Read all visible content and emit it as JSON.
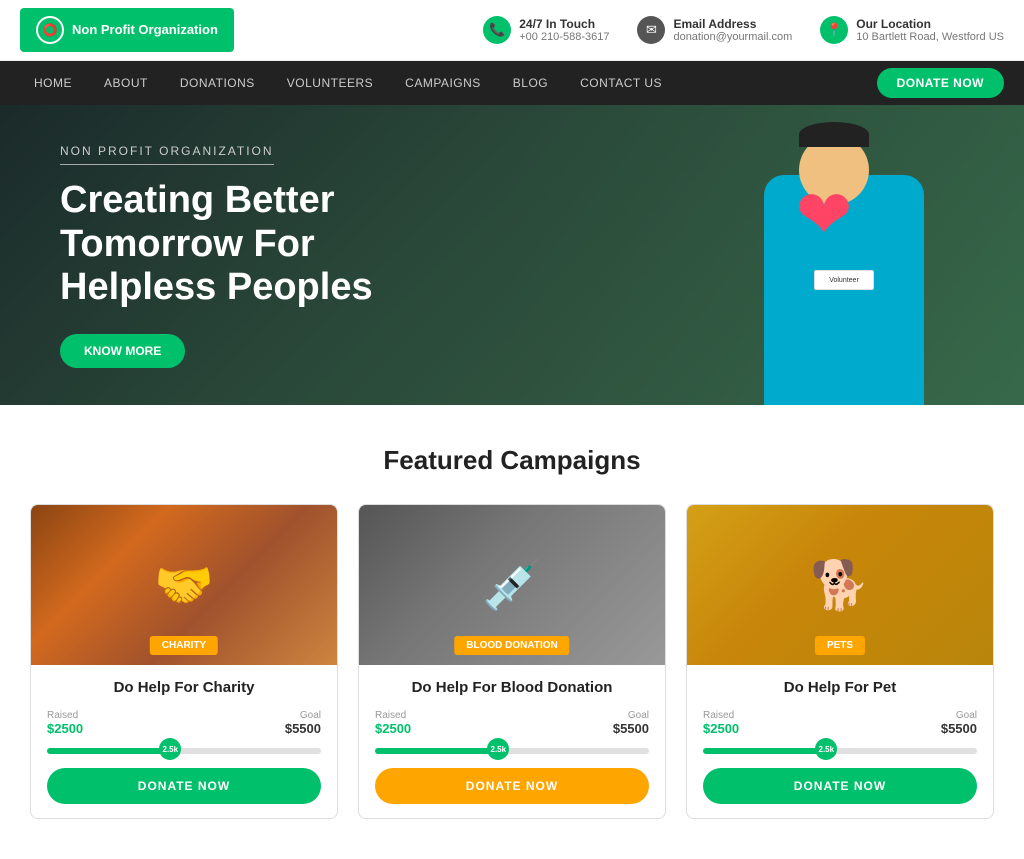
{
  "topbar": {
    "logo_name": "Non Profit Organization",
    "contact1_icon": "📞",
    "contact1_label": "24/7 In Touch",
    "contact1_value": "+00 210-588-3617",
    "contact2_icon": "✉",
    "contact2_label": "Email Address",
    "contact2_value": "donation@yourmail.com",
    "contact3_icon": "📍",
    "contact3_label": "Our Location",
    "contact3_value": "10 Bartlett Road, Westford US"
  },
  "nav": {
    "links": [
      "HOME",
      "ABOUT",
      "DONATIONS",
      "VOLUNTEERS",
      "CAMPAIGNS",
      "BLOG",
      "CONTACT US"
    ],
    "donate_btn": "DONATE NOW"
  },
  "hero": {
    "subtitle": "NON PROFIT ORGANIZATION",
    "title": "Creating Better Tomorrow For Helpless Peoples",
    "know_btn": "KNOW MORE"
  },
  "campaigns": {
    "section_title": "Featured Campaigns",
    "cards": [
      {
        "id": "charity",
        "badge": "CHARITY",
        "title": "Do Help For Charity",
        "raised_label": "Raised",
        "raised_amount": "$2500",
        "goal_label": "Goal",
        "goal_amount": "$5500",
        "progress_pct": 45,
        "marker_label": "2.5k",
        "btn_label": "DONATE NOW",
        "btn_style": "green"
      },
      {
        "id": "blood",
        "badge": "BLOOD DONATION",
        "title": "Do Help For Blood Donation",
        "raised_label": "Raised",
        "raised_amount": "$2500",
        "goal_label": "Goal",
        "goal_amount": "$5500",
        "progress_pct": 45,
        "marker_label": "2.5k",
        "btn_label": "DONATE NOW",
        "btn_style": "orange"
      },
      {
        "id": "pets",
        "badge": "PETS",
        "title": "Do Help For Pet",
        "raised_label": "Raised",
        "raised_amount": "$2500",
        "goal_label": "Goal",
        "goal_amount": "$5500",
        "progress_pct": 45,
        "marker_label": "2.5k",
        "btn_label": "DONATE NOW",
        "btn_style": "green"
      }
    ]
  }
}
